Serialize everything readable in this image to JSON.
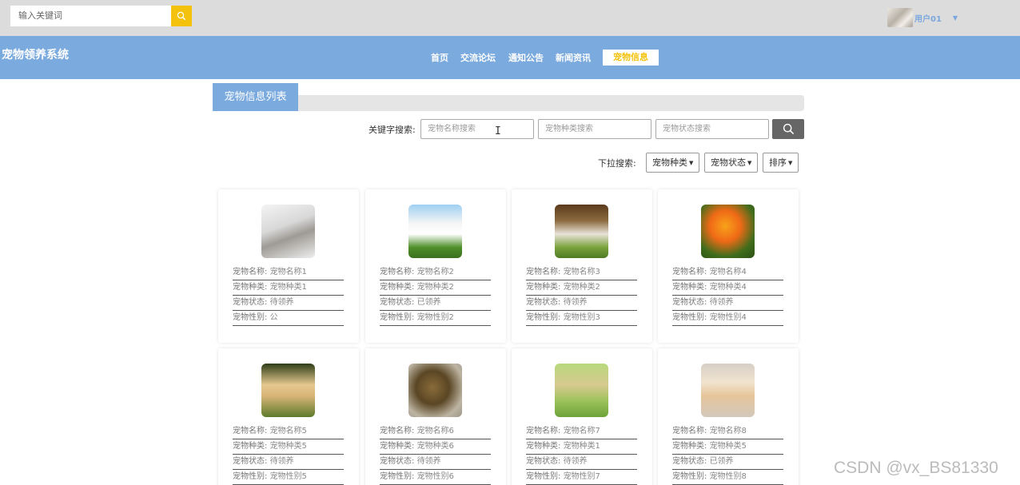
{
  "top": {
    "search_placeholder": "输入关键词",
    "user_name": "用户01",
    "user_caret": "▼"
  },
  "nav": {
    "brand": "宠物领养系统",
    "items": [
      "首页",
      "交流论坛",
      "通知公告",
      "新闻资讯"
    ],
    "active": "宠物信息"
  },
  "section": {
    "title": "宠物信息列表"
  },
  "keyword_search": {
    "label": "关键字搜索:",
    "name_placeholder": "宠物名称搜索",
    "type_placeholder": "宠物种类搜索",
    "status_placeholder": "宠物状态搜索"
  },
  "dropdown_search": {
    "label": "下拉搜索:",
    "type": "宠物种类",
    "status": "宠物状态",
    "sort": "排序"
  },
  "field_labels": {
    "name": "宠物名称: ",
    "type": "宠物种类: ",
    "status": "宠物状态: ",
    "gender": "宠物性别: "
  },
  "pets": [
    {
      "name": "宠物名称1",
      "type": "宠物种类1",
      "status": "待领养",
      "gender": "公"
    },
    {
      "name": "宠物名称2",
      "type": "宠物种类2",
      "status": "已领养",
      "gender": "宠物性别2"
    },
    {
      "name": "宠物名称3",
      "type": "宠物种类2",
      "status": "待领养",
      "gender": "宠物性别3"
    },
    {
      "name": "宠物名称4",
      "type": "宠物种类4",
      "status": "待领养",
      "gender": "宠物性别4"
    },
    {
      "name": "宠物名称5",
      "type": "宠物种类5",
      "status": "待领养",
      "gender": "宠物性别5"
    },
    {
      "name": "宠物名称6",
      "type": "宠物种类6",
      "status": "待领养",
      "gender": "宠物性别6"
    },
    {
      "name": "宠物名称7",
      "type": "宠物种类1",
      "status": "待领养",
      "gender": "宠物性别7"
    },
    {
      "name": "宠物名称8",
      "type": "宠物种类5",
      "status": "已领养",
      "gender": "宠物性别8"
    }
  ],
  "watermark": "CSDN @vx_BS81330",
  "colors": {
    "accent_blue": "#7aaade",
    "accent_yellow": "#f4c20d",
    "topbar_gray": "#dcdcdc"
  }
}
